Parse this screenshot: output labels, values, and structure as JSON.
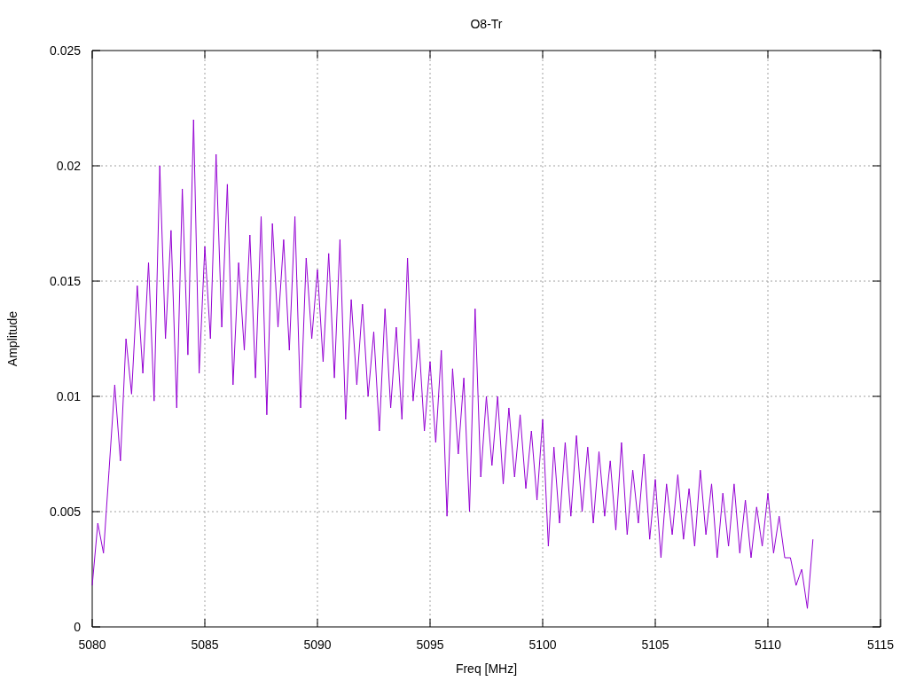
{
  "chart_data": {
    "type": "line",
    "title": "O8-Tr",
    "xlabel": "Freq [MHz]",
    "ylabel": "Amplitude",
    "xlim": [
      5080,
      5115
    ],
    "ylim": [
      0,
      0.025
    ],
    "grid": true,
    "xticks": [
      5080,
      5085,
      5090,
      5095,
      5100,
      5105,
      5110,
      5115
    ],
    "yticks": [
      {
        "value": 0,
        "label": "0"
      },
      {
        "value": 0.005,
        "label": "0.005"
      },
      {
        "value": 0.01,
        "label": "0.01"
      },
      {
        "value": 0.015,
        "label": "0.015"
      },
      {
        "value": 0.02,
        "label": "0.02"
      },
      {
        "value": 0.025,
        "label": "0.025"
      }
    ],
    "x": [
      5080,
      5080.25,
      5080.5,
      5080.75,
      5081,
      5081.25,
      5081.5,
      5081.75,
      5082,
      5082.25,
      5082.5,
      5082.75,
      5083,
      5083.25,
      5083.5,
      5083.75,
      5084,
      5084.25,
      5084.5,
      5084.75,
      5085,
      5085.25,
      5085.5,
      5085.75,
      5086,
      5086.25,
      5086.5,
      5086.75,
      5087,
      5087.25,
      5087.5,
      5087.75,
      5088,
      5088.25,
      5088.5,
      5088.75,
      5089,
      5089.25,
      5089.5,
      5089.75,
      5090,
      5090.25,
      5090.5,
      5090.75,
      5091,
      5091.25,
      5091.5,
      5091.75,
      5092,
      5092.25,
      5092.5,
      5092.75,
      5093,
      5093.25,
      5093.5,
      5093.75,
      5094,
      5094.25,
      5094.5,
      5094.75,
      5095,
      5095.25,
      5095.5,
      5095.75,
      5096,
      5096.25,
      5096.5,
      5096.75,
      5097,
      5097.25,
      5097.5,
      5097.75,
      5098,
      5098.25,
      5098.5,
      5098.75,
      5099,
      5099.25,
      5099.5,
      5099.75,
      5100,
      5100.25,
      5100.5,
      5100.75,
      5101,
      5101.25,
      5101.5,
      5101.75,
      5102,
      5102.25,
      5102.5,
      5102.75,
      5103,
      5103.25,
      5103.5,
      5103.75,
      5104,
      5104.25,
      5104.5,
      5104.75,
      5105,
      5105.25,
      5105.5,
      5105.75,
      5106,
      5106.25,
      5106.5,
      5106.75,
      5107,
      5107.25,
      5107.5,
      5107.75,
      5108,
      5108.25,
      5108.5,
      5108.75,
      5109,
      5109.25,
      5109.5,
      5109.75,
      5110,
      5110.25,
      5110.5,
      5110.75,
      5111,
      5111.25,
      5111.5,
      5111.75,
      5112
    ],
    "series": [
      {
        "color": "#9400d3",
        "values": [
          0.0018,
          0.0045,
          0.0032,
          0.0068,
          0.0105,
          0.0072,
          0.0125,
          0.0101,
          0.0148,
          0.011,
          0.0158,
          0.0098,
          0.02,
          0.0125,
          0.0172,
          0.0095,
          0.019,
          0.0118,
          0.022,
          0.011,
          0.0165,
          0.0125,
          0.0205,
          0.013,
          0.0192,
          0.0105,
          0.0158,
          0.012,
          0.017,
          0.0108,
          0.0178,
          0.0092,
          0.0175,
          0.013,
          0.0168,
          0.012,
          0.0178,
          0.0095,
          0.016,
          0.0125,
          0.0155,
          0.0115,
          0.0162,
          0.0108,
          0.0168,
          0.009,
          0.0142,
          0.0105,
          0.014,
          0.01,
          0.0128,
          0.0085,
          0.0138,
          0.0095,
          0.013,
          0.009,
          0.016,
          0.0098,
          0.0125,
          0.0085,
          0.0115,
          0.008,
          0.012,
          0.0048,
          0.0112,
          0.0075,
          0.0108,
          0.005,
          0.0138,
          0.0065,
          0.01,
          0.007,
          0.01,
          0.0062,
          0.0095,
          0.0065,
          0.0092,
          0.006,
          0.0085,
          0.0055,
          0.009,
          0.0035,
          0.0078,
          0.0045,
          0.008,
          0.0048,
          0.0083,
          0.005,
          0.0078,
          0.0045,
          0.0076,
          0.0048,
          0.0072,
          0.0042,
          0.008,
          0.004,
          0.0068,
          0.0045,
          0.0075,
          0.0038,
          0.0064,
          0.003,
          0.0062,
          0.004,
          0.0066,
          0.0038,
          0.006,
          0.0035,
          0.0068,
          0.004,
          0.0062,
          0.003,
          0.0058,
          0.0035,
          0.0062,
          0.0032,
          0.0055,
          0.003,
          0.0052,
          0.0035,
          0.0058,
          0.0032,
          0.0048,
          0.003,
          0.003,
          0.0018,
          0.0025,
          0.0008,
          0.0038
        ]
      }
    ]
  }
}
